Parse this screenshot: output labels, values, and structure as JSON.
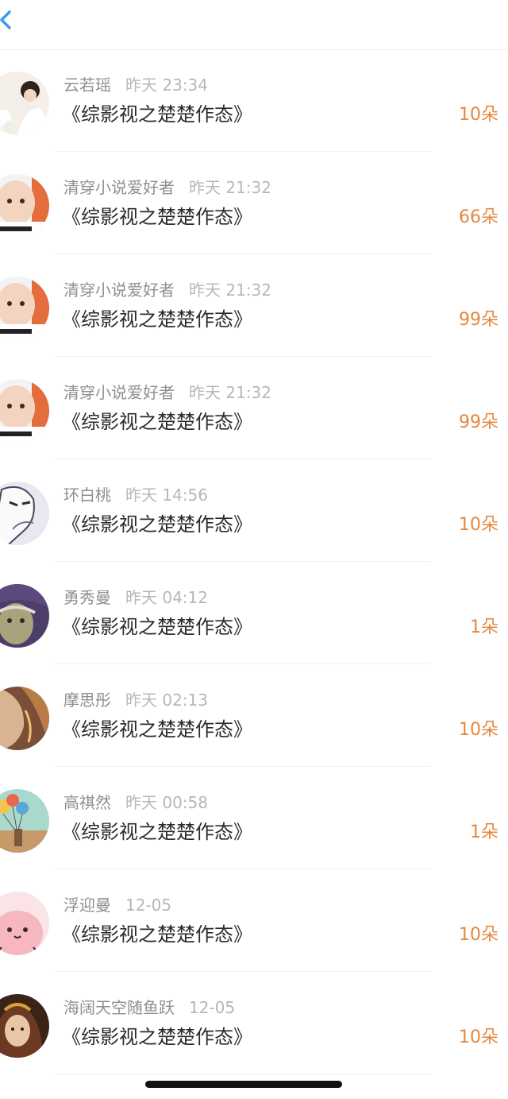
{
  "header": {
    "back_icon": "chevron-left-icon"
  },
  "rows": [
    {
      "name": "云若瑶",
      "time": "昨天 23:34",
      "title": "《综影视之楚楚作态》",
      "amount": "10朵",
      "avatar": "woman-with-flowers-avatar"
    },
    {
      "name": "清穿小说爱好者",
      "time": "昨天 21:32",
      "title": "《综影视之楚楚作态》",
      "amount": "66朵",
      "avatar": "baby-meme-avatar"
    },
    {
      "name": "清穿小说爱好者",
      "time": "昨天 21:32",
      "title": "《综影视之楚楚作态》",
      "amount": "99朵",
      "avatar": "baby-meme-avatar"
    },
    {
      "name": "清穿小说爱好者",
      "time": "昨天 21:32",
      "title": "《综影视之楚楚作态》",
      "amount": "99朵",
      "avatar": "baby-meme-avatar"
    },
    {
      "name": "环白桃",
      "time": "昨天 14:56",
      "title": "《综影视之楚楚作态》",
      "amount": "10朵",
      "avatar": "sketch-portrait-avatar"
    },
    {
      "name": "勇秀曼",
      "time": "昨天 04:12",
      "title": "《综影视之楚楚作态》",
      "amount": "1朵",
      "avatar": "anime-character-avatar"
    },
    {
      "name": "摩思彤",
      "time": "昨天 02:13",
      "title": "《综影视之楚楚作态》",
      "amount": "10朵",
      "avatar": "painted-face-avatar"
    },
    {
      "name": "高祺然",
      "time": "昨天 00:58",
      "title": "《综影视之楚楚作态》",
      "amount": "1朵",
      "avatar": "balloons-illustration-avatar"
    },
    {
      "name": "浮迎曼",
      "time": "12-05",
      "title": "《综影视之楚楚作态》",
      "amount": "10朵",
      "avatar": "pink-cartoon-avatar"
    },
    {
      "name": "海阔天空随鱼跃",
      "time": "12-05",
      "title": "《综影视之楚楚作态》",
      "amount": "10朵",
      "avatar": "anime-girl-avatar"
    }
  ],
  "colors": {
    "accent_blue": "#3a9bf0",
    "amount_orange": "#e4883f",
    "name_gray": "#8f8f8f",
    "time_gray": "#b7b7b7",
    "title_dark": "#2b2b2b"
  }
}
